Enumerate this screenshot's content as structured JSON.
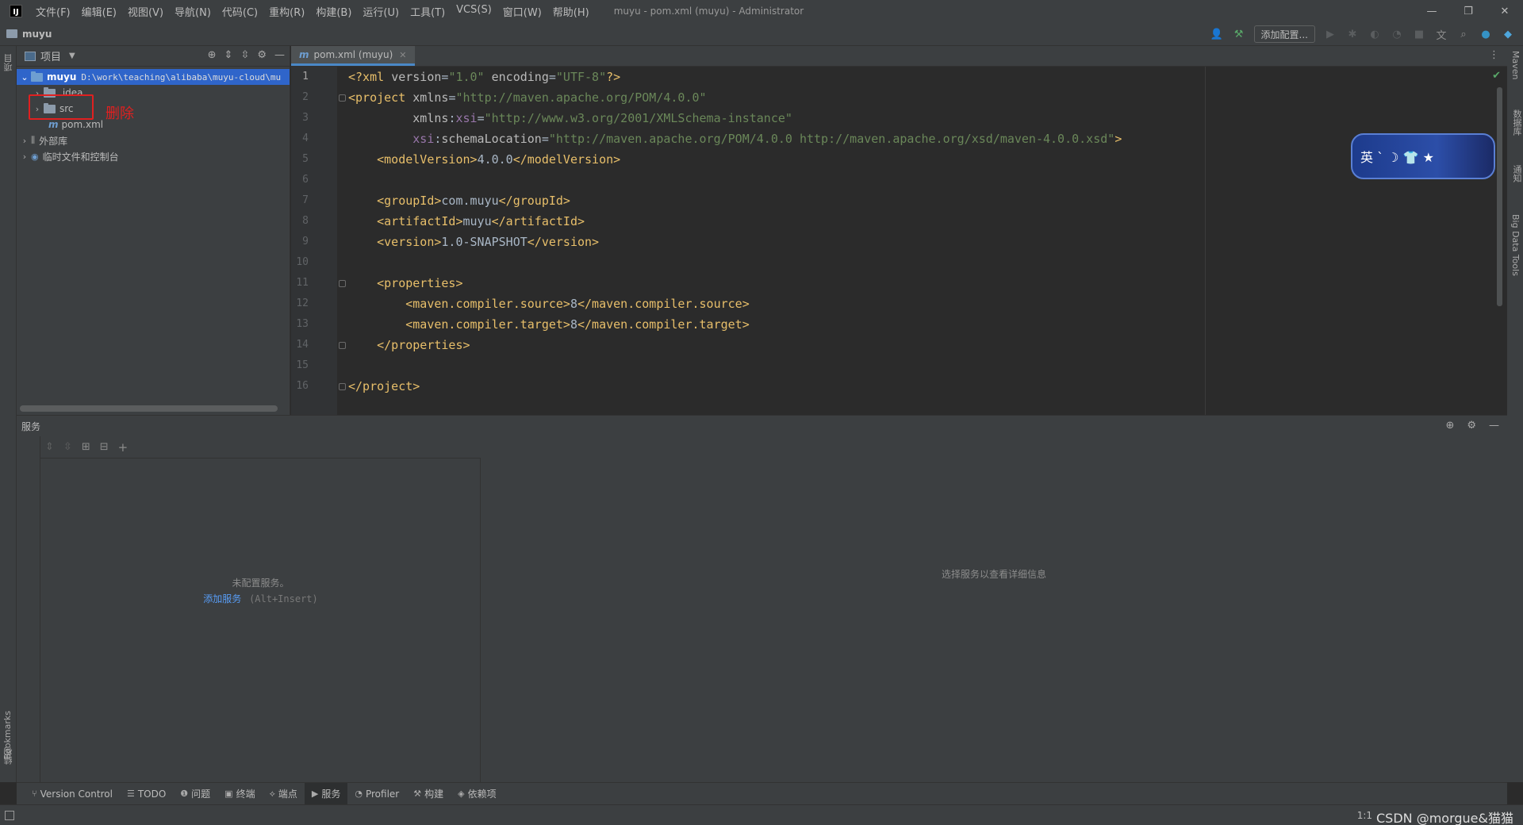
{
  "titlebar": {
    "logo_text": "IJ",
    "menu": [
      "文件(F)",
      "编辑(E)",
      "视图(V)",
      "导航(N)",
      "代码(C)",
      "重构(R)",
      "构建(B)",
      "运行(U)",
      "工具(T)",
      "VCS(S)",
      "窗口(W)",
      "帮助(H)"
    ],
    "window_title": "muyu - pom.xml (muyu) - Administrator"
  },
  "navbar": {
    "breadcrumb": "muyu",
    "add_config_label": "添加配置..."
  },
  "left_strip": {
    "top_label": "项目",
    "bookmarks_label": "Bookmarks",
    "structure_label": "结构"
  },
  "right_strip": {
    "maven_label": "Maven",
    "database_label": "数据库",
    "notifications_label": "通知",
    "bigdata_label": "Big Data Tools"
  },
  "project": {
    "title": "项目",
    "tree": [
      {
        "name": "muyu",
        "path": "D:\\work\\teaching\\alibaba\\muyu-cloud\\mu",
        "type": "module",
        "expanded": true,
        "selected": true
      },
      {
        "name": ".idea",
        "type": "folder",
        "expanded": false
      },
      {
        "name": "src",
        "type": "folder",
        "expanded": false
      },
      {
        "name": "pom.xml",
        "type": "maven-file"
      },
      {
        "name": "外部库",
        "type": "library",
        "expanded": false
      },
      {
        "name": "临时文件和控制台",
        "type": "scratches",
        "expanded": false
      }
    ],
    "annotation": "删除"
  },
  "editor": {
    "tab_label": "pom.xml (muyu)",
    "line_numbers": [
      "1",
      "2",
      "3",
      "4",
      "5",
      "6",
      "7",
      "8",
      "9",
      "10",
      "11",
      "12",
      "13",
      "14",
      "15",
      "16"
    ],
    "banner_text": "英 ˋ ☽ 👕 ★"
  },
  "services": {
    "title": "服务",
    "empty_text": "未配置服务。",
    "add_service_link": "添加服务",
    "add_service_shortcut": "(Alt+Insert)",
    "detail_placeholder": "选择服务以查看详细信息"
  },
  "bottom_tabs": [
    {
      "label": "Version Control",
      "icon": "branch-icon"
    },
    {
      "label": "TODO",
      "icon": "list-icon"
    },
    {
      "label": "问题",
      "icon": "info-icon"
    },
    {
      "label": "终端",
      "icon": "terminal-icon"
    },
    {
      "label": "端点",
      "icon": "endpoints-icon"
    },
    {
      "label": "服务",
      "icon": "services-icon",
      "active": true
    },
    {
      "label": "Profiler",
      "icon": "profiler-icon"
    },
    {
      "label": "构建",
      "icon": "hammer-icon"
    },
    {
      "label": "依赖项",
      "icon": "layers-icon"
    }
  ],
  "status": {
    "position": "1:1",
    "watermark": "CSDN @morgue&猫猫"
  },
  "colors": {
    "selection": "#2f65ca",
    "annotation_red": "#e02020",
    "link_blue": "#589df6",
    "tag_yellow": "#e8bf6a",
    "string_green": "#6a8759",
    "namespace_purple": "#9876aa"
  }
}
